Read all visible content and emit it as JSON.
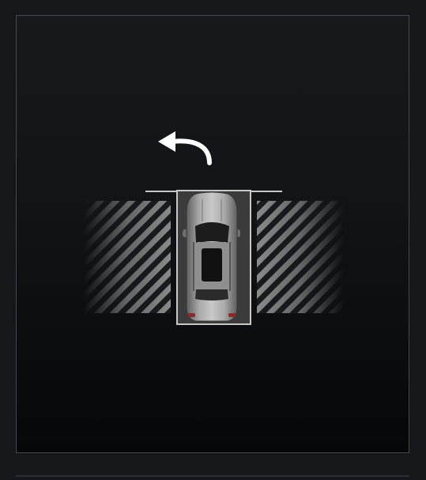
{
  "screen": {
    "view": "parking-assist-top-view",
    "maneuver_icon": "turn-left-arrow-icon",
    "vehicle_icon": "vehicle-top-view-icon",
    "colors": {
      "panel_border": "#45484e",
      "slot_outline": "#c8c8c8",
      "arrow": "#ffffff",
      "hatch_stripe": "#8a8a8a"
    }
  }
}
